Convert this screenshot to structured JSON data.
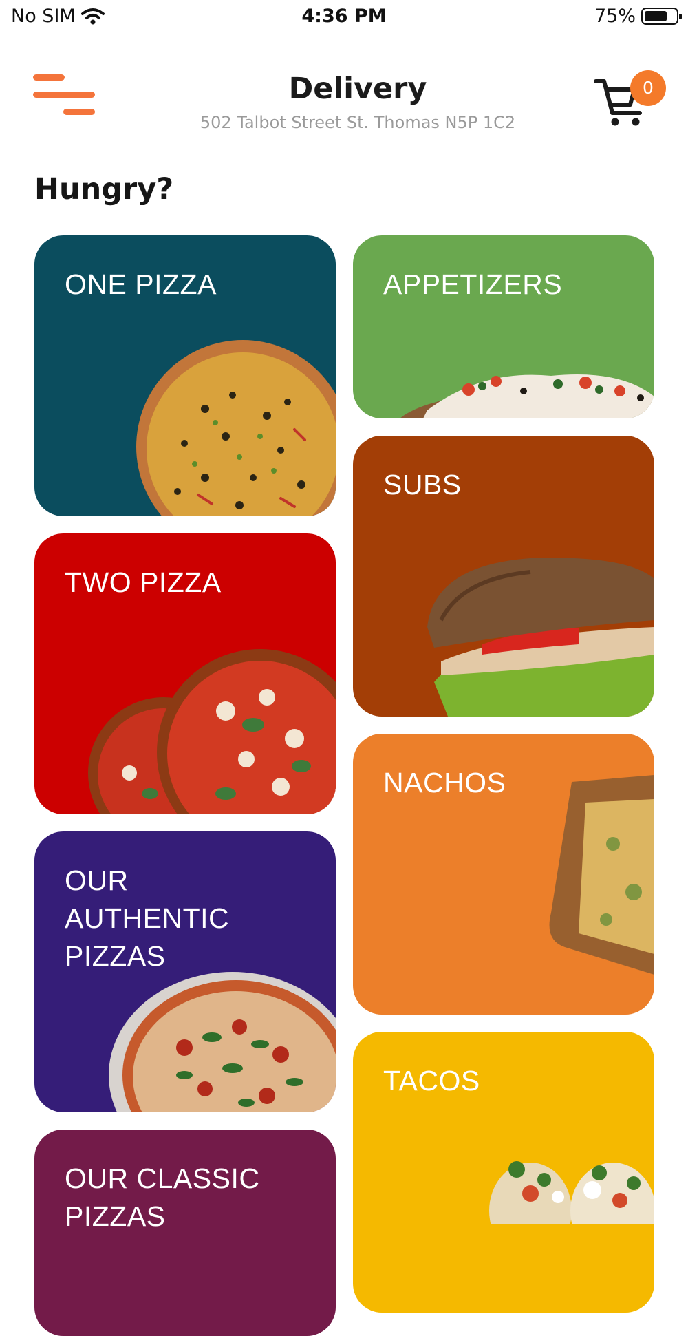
{
  "status_bar": {
    "carrier": "No SIM",
    "time": "4:36 PM",
    "battery": "75%",
    "battery_level": 0.75
  },
  "header": {
    "title": "Delivery",
    "address": "502 Talbot Street   St. Thomas N5P 1C2",
    "cart_count": "0",
    "menu_icon": "hamburger-menu-icon",
    "cart_icon": "shopping-cart-icon"
  },
  "page": {
    "section_title": "Hungry?"
  },
  "colors": {
    "accent": "#f47a2a",
    "one_pizza": "#0b4d5e",
    "two_pizza": "#cc0000",
    "authentic": "#351d78",
    "classic": "#731b49",
    "appetizers": "#6aa84f",
    "subs": "#a33e06",
    "nachos": "#ec7f2a",
    "tacos": "#f5b900"
  },
  "categories": [
    {
      "label": "ONE PIZZA"
    },
    {
      "label": "APPETIZERS"
    },
    {
      "label": "SUBS"
    },
    {
      "label": "TWO PIZZA"
    },
    {
      "label": "NACHOS"
    },
    {
      "label": "OUR AUTHENTIC PIZZAS"
    },
    {
      "label": "TACOS"
    },
    {
      "label": "OUR CLASSIC PIZZAS"
    }
  ]
}
